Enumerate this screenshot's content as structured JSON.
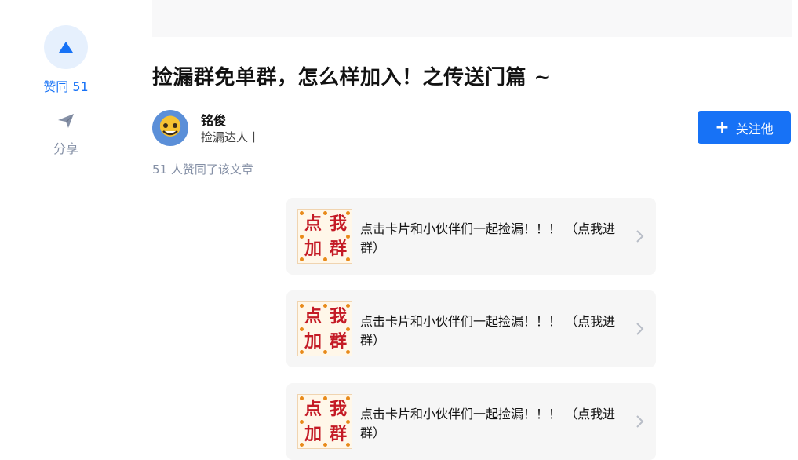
{
  "sidebar": {
    "vote_label": "赞同 51",
    "share_label": "分享"
  },
  "article": {
    "title": "捡漏群免单群，怎么样加入！之传送门篇 ~"
  },
  "author": {
    "name": "铭俊",
    "tag": "捡漏达人丨"
  },
  "follow": {
    "label": "关注他"
  },
  "vote_summary": "51 人赞同了该文章",
  "cards": [
    {
      "badge": [
        "点",
        "我",
        "加",
        "群"
      ],
      "text": "点击卡片和小伙伴们一起捡漏！！！ （点我进群）"
    },
    {
      "badge": [
        "点",
        "我",
        "加",
        "群"
      ],
      "text": "点击卡片和小伙伴们一起捡漏！！！ （点我进群）"
    },
    {
      "badge": [
        "点",
        "我",
        "加",
        "群"
      ],
      "text": "点击卡片和小伙伴们一起捡漏！！！ （点我进群）"
    }
  ],
  "colors": {
    "accent": "#1772f6",
    "muted": "#8590a6",
    "card_bg": "#f6f6f6"
  }
}
